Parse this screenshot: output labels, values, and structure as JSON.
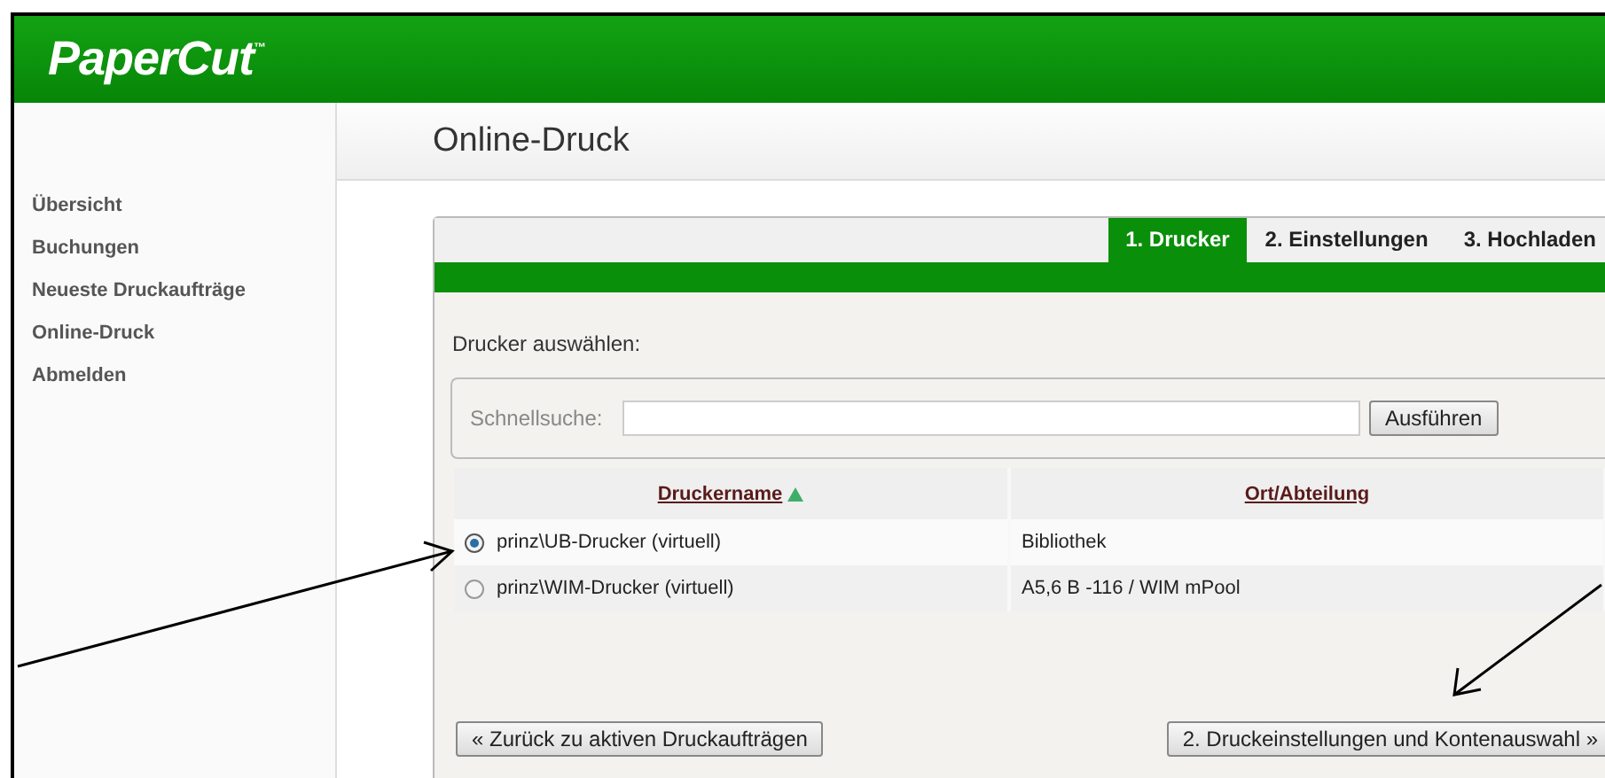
{
  "header": {
    "logo": "PaperCut$^{™}$"
  },
  "sidebar": {
    "items": [
      {
        "label": "Übersicht"
      },
      {
        "label": "Buchungen"
      },
      {
        "label": "Neueste Druckaufträge"
      },
      {
        "label": "Online-Druck"
      },
      {
        "label": "Abmelden"
      }
    ]
  },
  "page_title": "Online-Druck",
  "tabs": [
    {
      "label": "1. Drucker",
      "selected": true
    },
    {
      "label": "2. Einstellungen",
      "selected": false
    },
    {
      "label": "3. Hochladen",
      "selected": false
    }
  ],
  "instruction": "Drucker auswählen:",
  "search": {
    "label": "Schnellsuche:",
    "button": "Ausführen"
  },
  "table": {
    "columns": [
      {
        "label": "Druckername",
        "sorted": true
      },
      {
        "label": "Ort/Abteilung",
        "sorted": false
      }
    ],
    "rows": [
      {
        "name": "prinz\\UB-Drucker (virtuell)",
        "location": "Bibliothek",
        "selected": true
      },
      {
        "name": "prinz\\WIM-Drucker (virtuell)",
        "location": "A5,6 B -116 / WIM mPool",
        "selected": false
      }
    ]
  },
  "buttons": {
    "back": "« Zurück zu aktiven Druckaufträgen",
    "next": "2. Druckeinstellungen und Kontenauswahl »"
  }
}
